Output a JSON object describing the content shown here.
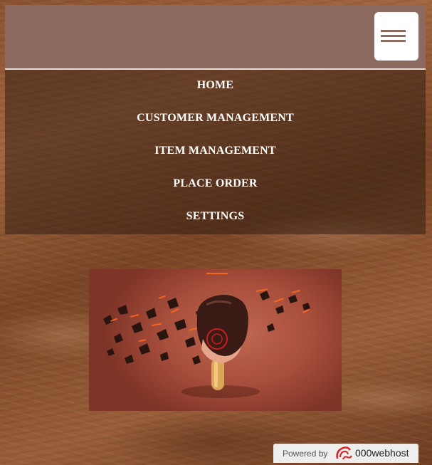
{
  "header": {
    "menu_toggle_icon": "hamburger-icon",
    "background_color": "#8c6a60"
  },
  "nav": {
    "items": [
      {
        "label": "HOME"
      },
      {
        "label": "CUSTOMER MANAGEMENT"
      },
      {
        "label": "ITEM MANAGEMENT"
      },
      {
        "label": "PLACE ORDER"
      },
      {
        "label": "SETTINGS"
      }
    ]
  },
  "hero": {
    "image": "chocolate-ice-cream-bar-image"
  },
  "footer_badge": {
    "powered_by": "Powered by",
    "brand": "000webhost",
    "logo_icon": "webhost-logo-icon",
    "brand_color": "#e02020"
  }
}
